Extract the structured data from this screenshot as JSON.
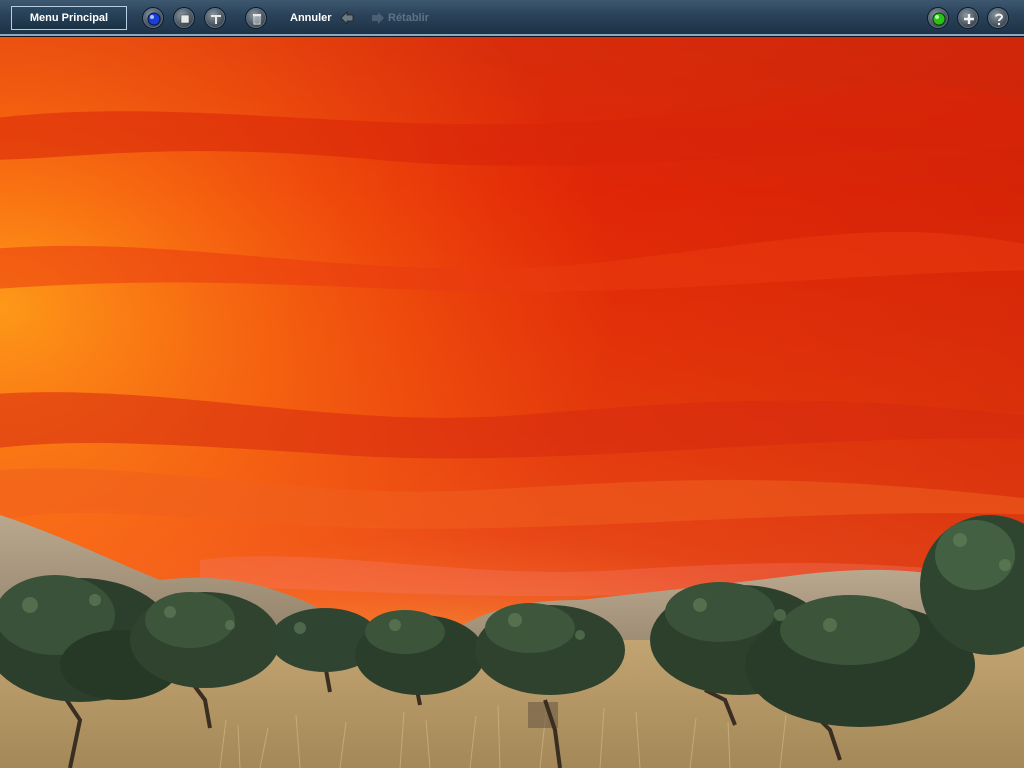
{
  "toolbar": {
    "main_menu_label": "Menu Principal",
    "undo_label": "Annuler",
    "redo_label": "Rétablir",
    "left_icons": [
      "view-orb-icon",
      "stop-icon",
      "wrench-icon",
      "trash-icon"
    ],
    "right_icons": [
      "green-status-icon",
      "plus-icon",
      "help-icon"
    ]
  },
  "colors": {
    "toolbar_bg": "#2a4259",
    "toolbar_border": "#8fa9bf",
    "label_active": "#ffffff",
    "label_disabled": "#5f7384",
    "sky_top": "#d92a0a",
    "sky_horizon": "#ffb321",
    "foliage": "#2f4430",
    "ground": "#b79a68"
  }
}
